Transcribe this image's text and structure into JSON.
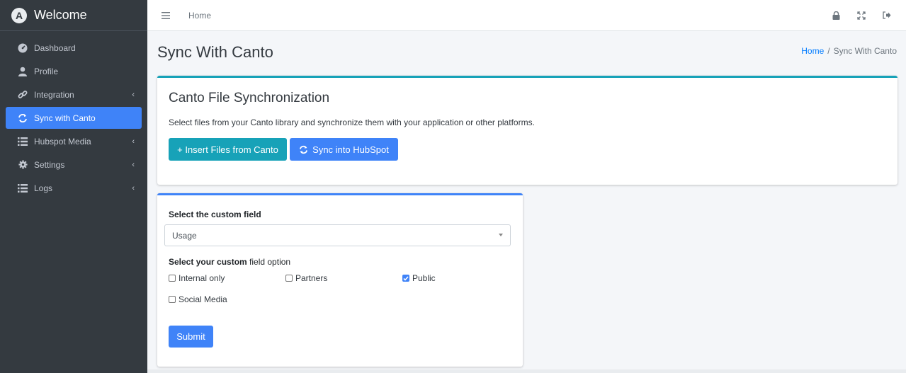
{
  "brand": {
    "logo_letter": "A",
    "title": "Welcome"
  },
  "sidebar": {
    "items": [
      {
        "label": "Dashboard",
        "icon": "tachometer-icon",
        "has_arrow": false,
        "active": false
      },
      {
        "label": "Profile",
        "icon": "user-icon",
        "has_arrow": false,
        "active": false
      },
      {
        "label": "Integration",
        "icon": "link-icon",
        "has_arrow": true,
        "active": false
      },
      {
        "label": "Sync with Canto",
        "icon": "sync-icon",
        "has_arrow": false,
        "active": true
      },
      {
        "label": "Hubspot Media",
        "icon": "list-icon",
        "has_arrow": true,
        "active": false
      },
      {
        "label": "Settings",
        "icon": "gear-icon",
        "has_arrow": true,
        "active": false
      },
      {
        "label": "Logs",
        "icon": "list-icon",
        "has_arrow": true,
        "active": false
      }
    ],
    "arrow_glyph": "‹"
  },
  "topbar": {
    "home_label": "Home",
    "icons": [
      "lock-icon",
      "expand-icon",
      "sign-out-icon"
    ]
  },
  "header": {
    "title": "Sync With Canto",
    "breadcrumb": {
      "home": "Home",
      "separator": "/",
      "current": "Sync With Canto"
    }
  },
  "sync_card": {
    "title": "Canto File Synchronization",
    "description": "Select files from your Canto library and synchronize them with your application or other platforms.",
    "insert_button": "+ Insert Files from Canto",
    "sync_button": "Sync into HubSpot"
  },
  "form_card": {
    "field_label": "Select the custom field",
    "select_value": "Usage",
    "option_label_bold": "Select your custom",
    "option_label_rest": " field option",
    "options": [
      {
        "label": "Internal only",
        "checked": false
      },
      {
        "label": "Partners",
        "checked": false
      },
      {
        "label": "Public",
        "checked": true
      },
      {
        "label": "Social Media",
        "checked": false
      }
    ],
    "submit_label": "Submit"
  },
  "colors": {
    "sidebar_bg": "#343a40",
    "active_blue": "#3f83f8",
    "teal": "#17a2b8"
  }
}
